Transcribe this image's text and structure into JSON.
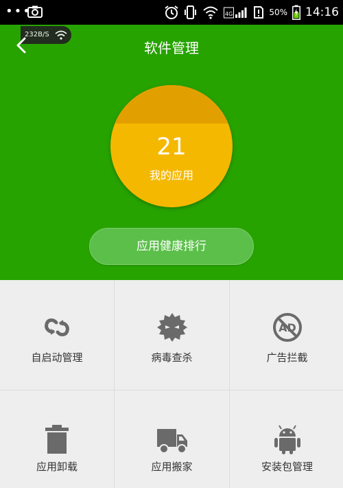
{
  "status_bar": {
    "dots": "•••",
    "battery_pct": "50%",
    "clock": "14:16"
  },
  "header": {
    "speed": "232B/S",
    "title": "软件管理",
    "app_count": "21",
    "app_count_label": "我的应用",
    "rank_button": "应用健康排行",
    "colors": {
      "background": "#27a300",
      "circle": "#f5b800"
    }
  },
  "grid": {
    "items": [
      {
        "label": "自启动管理",
        "icon": "autostart-icon"
      },
      {
        "label": "病毒查杀",
        "icon": "virus-icon"
      },
      {
        "label": "广告拦截",
        "icon": "ad-block-icon"
      },
      {
        "label": "应用卸载",
        "icon": "trash-icon"
      },
      {
        "label": "应用搬家",
        "icon": "truck-icon"
      },
      {
        "label": "安装包管理",
        "icon": "android-icon"
      }
    ]
  }
}
